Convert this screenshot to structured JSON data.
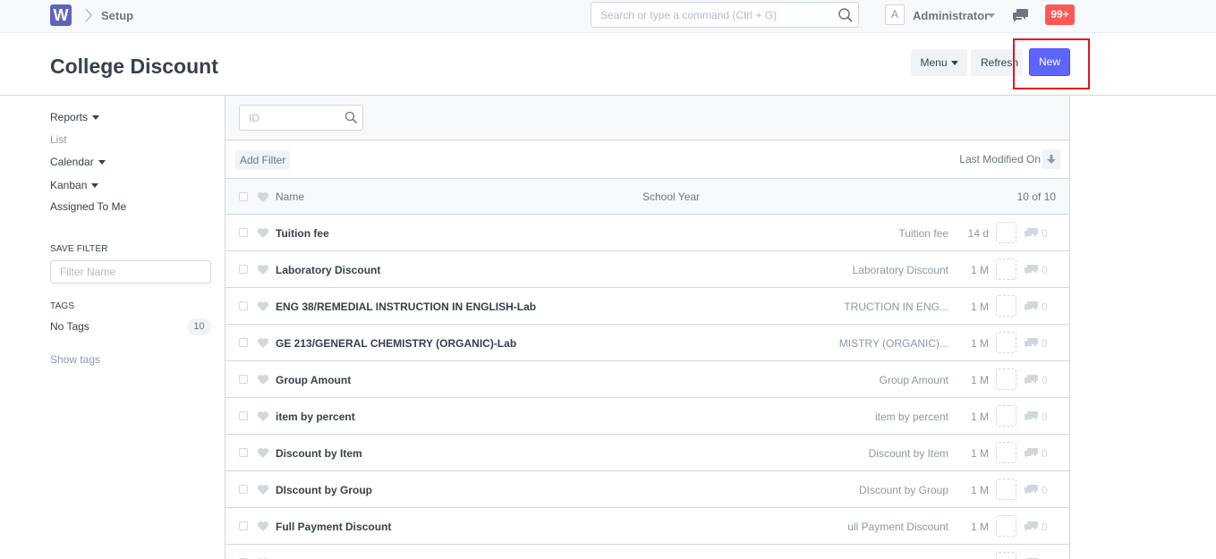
{
  "navbar": {
    "logo_letter": "W",
    "breadcrumb": "Setup",
    "search_placeholder": "Search or type a command (Ctrl + G)",
    "avatar_letter": "A",
    "user_name": "Administrator",
    "notifications": "99+"
  },
  "page": {
    "title": "College Discount",
    "menu_label": "Menu",
    "refresh_label": "Refresh",
    "new_label": "New",
    "annotation_color": "#e8131b",
    "primary_color": "#5e64ff"
  },
  "sidebar": {
    "views": [
      {
        "label": "Reports",
        "dropdown": true
      },
      {
        "label": "List",
        "dropdown": false
      },
      {
        "label": "Calendar",
        "dropdown": true
      },
      {
        "label": "Kanban",
        "dropdown": true
      },
      {
        "label": "Assigned To Me",
        "dropdown": false
      }
    ],
    "save_filter_heading": "SAVE FILTER",
    "filter_name_placeholder": "Filter Name",
    "tags_heading": "TAGS",
    "no_tags_label": "No Tags",
    "no_tags_count": "10",
    "show_tags_label": "Show tags"
  },
  "list": {
    "id_placeholder": "ID",
    "add_filter_label": "Add Filter",
    "sort_label": "Last Modified On",
    "columns": {
      "name": "Name",
      "school_year": "School Year"
    },
    "count_label": "10 of 10",
    "rows": [
      {
        "name": "Tuition fee",
        "school_year": "Tuition fee",
        "modified": "14 d",
        "comments": "0"
      },
      {
        "name": "Laboratory Discount",
        "school_year": "Laboratory Discount",
        "modified": "1 M",
        "comments": "0"
      },
      {
        "name": "ENG 38/REMEDIAL INSTRUCTION IN ENGLISH-Lab",
        "school_year": "TRUCTION IN ENG...",
        "modified": "1 M",
        "comments": "0"
      },
      {
        "name": "GE 213/GENERAL CHEMISTRY (ORGANIC)-Lab",
        "school_year": "MISTRY (ORGANIC)...",
        "modified": "1 M",
        "comments": "0"
      },
      {
        "name": "Group Amount",
        "school_year": "Group Amount",
        "modified": "1 M",
        "comments": "0"
      },
      {
        "name": "item by percent",
        "school_year": "item by percent",
        "modified": "1 M",
        "comments": "0"
      },
      {
        "name": "Discount by Item",
        "school_year": "Discount by Item",
        "modified": "1 M",
        "comments": "0"
      },
      {
        "name": "DIscount by Group",
        "school_year": "DIscount by Group",
        "modified": "1 M",
        "comments": "0"
      },
      {
        "name": "Full Payment Discount",
        "school_year": "ull Payment Discount",
        "modified": "1 M",
        "comments": "0"
      },
      {
        "name": "",
        "school_year": "",
        "modified": "",
        "comments": "0"
      }
    ]
  }
}
